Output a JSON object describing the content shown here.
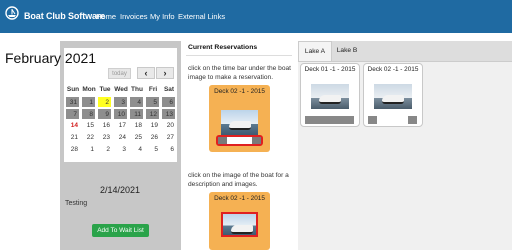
{
  "app": {
    "brand": "Boat Club Software"
  },
  "nav": [
    "Home",
    "Invoices",
    "My Info",
    "External Links"
  ],
  "calendar": {
    "title": "February 2021",
    "today_label": "today",
    "prev": "‹",
    "next": "›",
    "weekdays": [
      "Sun",
      "Mon",
      "Tue",
      "Wed",
      "Thu",
      "Fri",
      "Sat"
    ],
    "weeks": [
      [
        "31",
        "1",
        "2",
        "3",
        "4",
        "5",
        "6"
      ],
      [
        "7",
        "8",
        "9",
        "10",
        "11",
        "12",
        "13"
      ],
      [
        "14",
        "15",
        "16",
        "17",
        "18",
        "19",
        "20"
      ],
      [
        "21",
        "22",
        "23",
        "24",
        "25",
        "26",
        "27"
      ],
      [
        "28",
        "1",
        "2",
        "3",
        "4",
        "5",
        "6"
      ]
    ],
    "today": "14",
    "selected": "2"
  },
  "selected_date": "2/14/2021",
  "user": "Testing",
  "waitlist_button": "Add To Wait List",
  "reservations": {
    "title": "Current Reservations",
    "instruction1": "click on the time bar under the boat image to make a reservation.",
    "instruction2": "click on the image of the boat for a description and images.",
    "cards": [
      {
        "label": "Deck 02 -1 - 2015"
      },
      {
        "label": "Deck 02 -1 - 2015"
      }
    ]
  },
  "lakes": {
    "tabs": [
      "Lake A",
      "Lake B"
    ],
    "active_tab": "Lake A",
    "boats": [
      {
        "label": "Deck 01 -1 - 2015"
      },
      {
        "label": "Deck 02 -1 - 2015"
      }
    ]
  },
  "colors": {
    "navbar": "#1f6aa2",
    "reservation_card": "#f5b153",
    "time_bar_border": "#e02020",
    "waitlist_button": "#2aa34a",
    "selected_day": "#ffff22",
    "today_text": "#d21d1d"
  },
  "icons": {
    "logo": "boat-club-logo-icon"
  }
}
